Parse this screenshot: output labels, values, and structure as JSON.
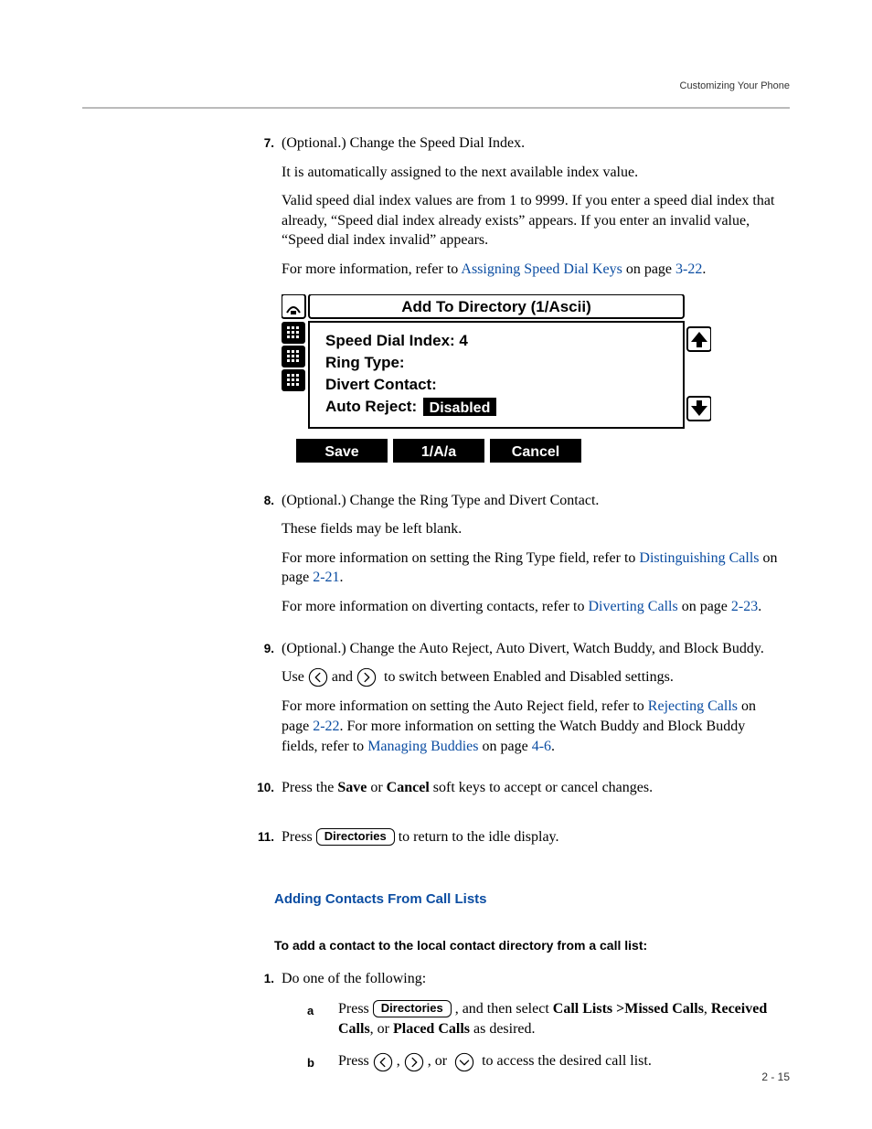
{
  "running_head": "Customizing Your Phone",
  "page_number": "2 - 15",
  "steps": {
    "s7": {
      "num": "7.",
      "line1": "(Optional.) Change the Speed Dial Index.",
      "line2": "It is automatically assigned to the next available index value.",
      "line3": "Valid speed dial index values are from 1 to 9999. If you enter a speed dial index that already, “Speed dial index already exists” appears. If you enter an invalid value, “Speed dial index invalid” appears.",
      "line4_pre": "For more information, refer to ",
      "line4_link": "Assigning Speed Dial Keys",
      "line4_mid": " on page ",
      "line4_page": "3-22",
      "line4_post": "."
    },
    "s8": {
      "num": "8.",
      "line1": "(Optional.) Change the Ring Type and Divert Contact.",
      "line2": "These fields may be left blank.",
      "line3_pre": "For more information on setting the Ring Type field, refer to ",
      "line3_link": "Distinguishing Calls",
      "line3_mid": " on page ",
      "line3_page": "2-21",
      "line3_post": ".",
      "line4_pre": "For more information on diverting contacts, refer to ",
      "line4_link": "Diverting Calls",
      "line4_mid": " on page ",
      "line4_page": "2-23",
      "line4_post": "."
    },
    "s9": {
      "num": "9.",
      "line1": "(Optional.) Change the Auto Reject, Auto Divert, Watch Buddy, and Block Buddy.",
      "line2_pre": "Use ",
      "line2_mid": " and ",
      "line2_post": " to switch between Enabled and Disabled settings.",
      "line3_pre": "For more information on setting the Auto Reject field, refer to ",
      "line3_link": "Rejecting Calls",
      "line3_mid1": " on page ",
      "line3_page1": "2-22",
      "line3_mid2": ". For more information on setting the Watch Buddy and Block Buddy fields, refer to ",
      "line3_link2": "Managing Buddies",
      "line3_mid3": " on page ",
      "line3_page2": "4-6",
      "line3_post": "."
    },
    "s10": {
      "num": "10.",
      "text_pre": "Press the ",
      "save": "Save",
      "text_mid": " or ",
      "cancel": "Cancel",
      "text_post": " soft keys to accept or cancel changes."
    },
    "s11": {
      "num": "11.",
      "text_pre": "Press ",
      "key": "Directories",
      "text_post": " to return to the idle display."
    }
  },
  "section_heading": "Adding Contacts From Call Lists",
  "procedure_heading": "To add a contact to the local contact directory from a call list:",
  "proc": {
    "p1": {
      "num": "1.",
      "text": "Do one of the following:",
      "a": {
        "letter": "a",
        "pre": "Press ",
        "key": "Directories",
        "mid": " , and then select ",
        "b1": "Call Lists >Missed Calls",
        "sep1": ", ",
        "b2": "Received Calls",
        "sep2": ", or ",
        "b3": "Placed Calls",
        "post": " as desired."
      },
      "b": {
        "letter": "b",
        "pre": "Press ",
        "sep1": " , ",
        "sep2": " , or ",
        "post": " to access the desired call list."
      }
    }
  },
  "phone_screen": {
    "title": "Add To Directory (1/Ascii)",
    "row1": "Speed Dial Index: 4",
    "row2": "Ring Type:",
    "row3": "Divert Contact:",
    "row4_label": "Auto Reject:",
    "row4_value": "Disabled",
    "softkeys": {
      "k1": "Save",
      "k2": "1/A/a",
      "k3": "Cancel"
    }
  }
}
